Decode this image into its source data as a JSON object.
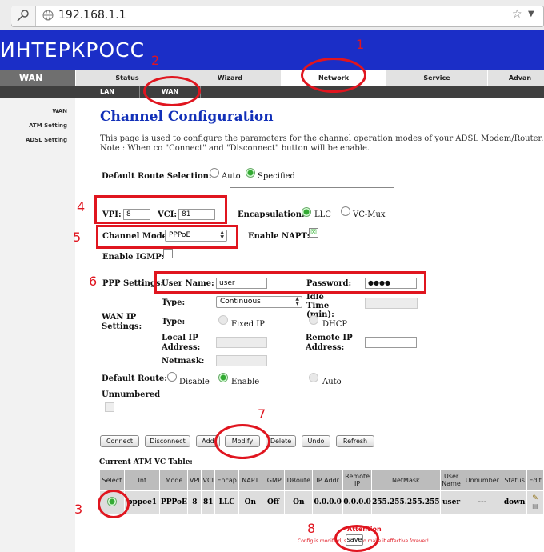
{
  "browser": {
    "url": "192.168.1.1"
  },
  "header": {
    "brand": "ИНТЕРКРОСС"
  },
  "nav": {
    "section": "WAN",
    "tabs": [
      "Status",
      "Wizard",
      "Network",
      "Service",
      "Advan"
    ],
    "active_tab": "Network",
    "subtabs": [
      "LAN",
      "WAN"
    ]
  },
  "sidebar": {
    "items": [
      "WAN",
      "ATM Setting",
      "ADSL Setting"
    ]
  },
  "page": {
    "title": "Channel Configuration",
    "description": "This page is used to configure the parameters for the channel operation modes of your ADSL Modem/Router. Note : When co \"Connect\" and \"Disconnect\" button will be enable."
  },
  "form": {
    "default_route_selection_label": "Default Route Selection:",
    "auto_label": "Auto",
    "specified_label": "Specified",
    "vpi_label": "VPI:",
    "vpi_value": "8",
    "vci_label": "VCI:",
    "vci_value": "81",
    "encapsulation_label": "Encapsulation:",
    "llc_label": "LLC",
    "vcmux_label": "VC-Mux",
    "channel_mode_label": "Channel Mode:",
    "channel_mode_value": "PPPoE",
    "enable_napt_label": "Enable NAPT:",
    "enable_igmp_label": "Enable IGMP:",
    "ppp_settings_label": "PPP Settings:",
    "username_label": "User Name:",
    "username_value": "user",
    "password_label": "Password:",
    "password_value": "●●●●",
    "type_label": "Type:",
    "type_value": "Continuous",
    "idle_time_label": "Idle Time (min):",
    "wan_ip_settings_label": "WAN IP Settings:",
    "wan_type_label": "Type:",
    "fixed_ip_label": "Fixed IP",
    "dhcp_label": "DHCP",
    "local_ip_label": "Local IP Address:",
    "remote_ip_label": "Remote IP Address:",
    "netmask_label": "Netmask:",
    "default_route_label": "Default Route:",
    "disable_label": "Disable",
    "enable_label": "Enable",
    "auto2_label": "Auto",
    "unnumbered_label": "Unnumbered"
  },
  "buttons": [
    "Connect",
    "Disconnect",
    "Add",
    "Modify",
    "Delete",
    "Undo",
    "Refresh"
  ],
  "table": {
    "caption": "Current ATM VC Table:",
    "headers": [
      "Select",
      "Inf",
      "Mode",
      "VPI",
      "VCI",
      "Encap",
      "NAPT",
      "IGMP",
      "DRoute",
      "IP Addr",
      "Remote IP",
      "NetMask",
      "User Name",
      "Unnumber",
      "Status",
      "Edit"
    ],
    "rows": [
      [
        "",
        "pppoe1",
        "PPPoE",
        "8",
        "81",
        "LLC",
        "On",
        "Off",
        "On",
        "0.0.0.0",
        "0.0.0.0",
        "255.255.255.255",
        "user",
        "---",
        "down",
        ""
      ]
    ]
  },
  "footer": {
    "attention": "Attention",
    "message": "Config is modified, save it to make it effective forever!",
    "save_label": "save"
  },
  "annotations": [
    "1",
    "2",
    "3",
    "4",
    "5",
    "6",
    "7",
    "8"
  ],
  "colors": {
    "banner": "#1b2ec7",
    "title": "#1230b8",
    "annotation": "#e0151f"
  }
}
